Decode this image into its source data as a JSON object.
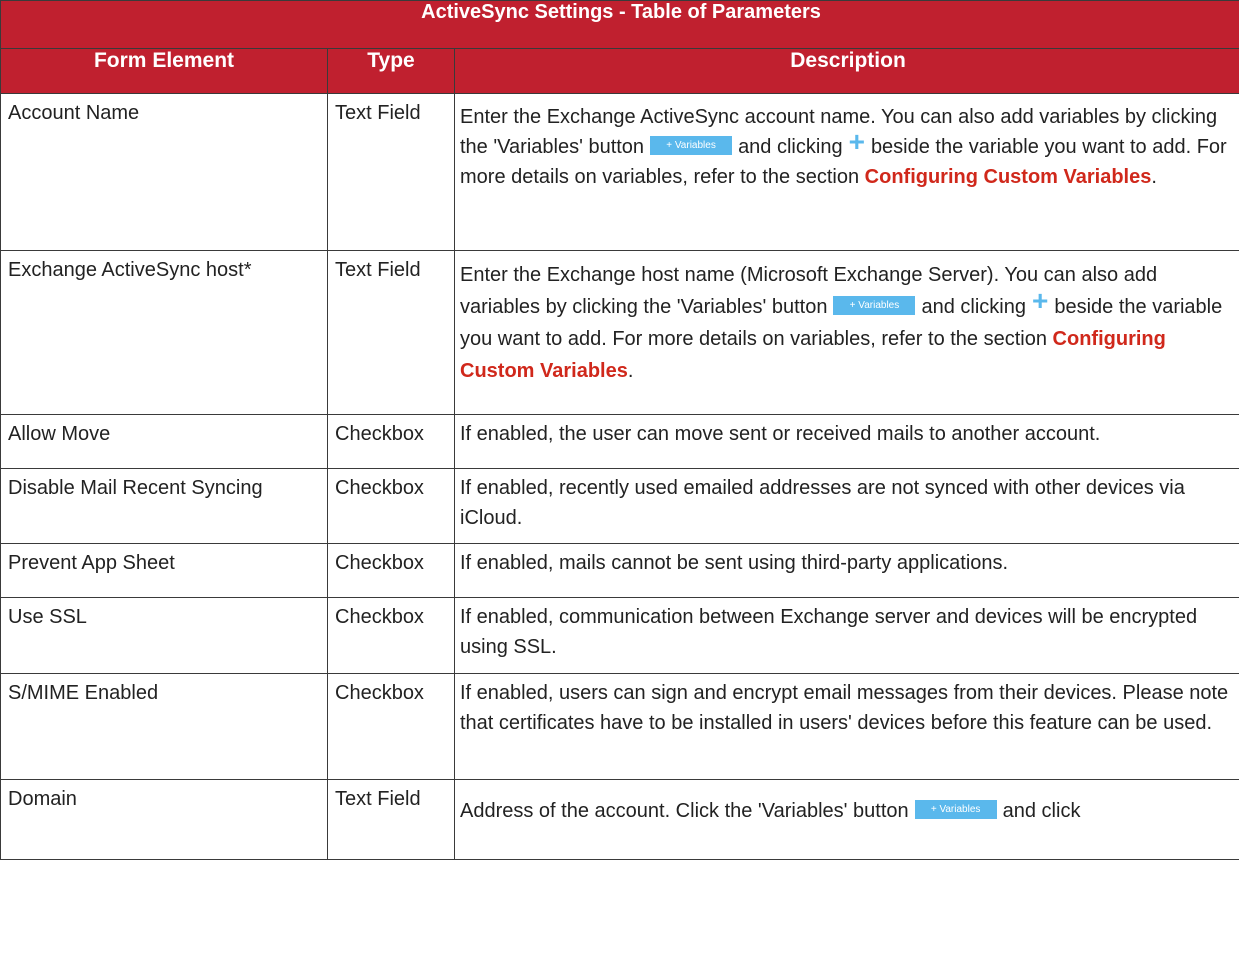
{
  "table": {
    "title": "ActiveSync Settings - Table of Parameters",
    "headers": [
      "Form Element",
      "Type",
      "Description"
    ],
    "variables_button_label": "+ Variables",
    "rows": [
      {
        "element": "Account Name",
        "type": "Text Field",
        "desc": {
          "p1": "Enter the Exchange ActiveSync account name. You can also add variables by clicking the 'Variables' button",
          "p2": "and clicking",
          "p3": "beside the variable you want to add. For more details on variables, refer to the section",
          "link": "Configuring Custom Variables",
          "end": "."
        }
      },
      {
        "element": "Exchange ActiveSync host*",
        "type": "Text Field",
        "desc": {
          "p1": "Enter the Exchange host name (Microsoft Exchange Server). You can also add variables by clicking the 'Variables' button",
          "p2": "and clicking",
          "p3": "beside the variable you want to add. For more details on variables, refer to the section",
          "link": "Configuring Custom Variables",
          "end": "."
        }
      },
      {
        "element": "Allow Move",
        "type": "Checkbox",
        "desc": "If enabled, the user can move sent or received mails to another account."
      },
      {
        "element": "Disable Mail Recent Syncing",
        "type": "Checkbox",
        "desc": "If enabled, recently used emailed addresses are not synced with other devices via iCloud."
      },
      {
        "element": "Prevent App Sheet",
        "type": "Checkbox",
        "desc": "If enabled, mails cannot be sent using third-party applications."
      },
      {
        "element": "Use SSL",
        "type": "Checkbox",
        "desc": "If enabled, communication between Exchange server and devices will be encrypted using SSL."
      },
      {
        "element": "S/MIME Enabled",
        "type": "Checkbox",
        "desc": "If enabled, users can sign and encrypt email messages from their devices. Please note that certificates have to be installed in users' devices before this feature can be used."
      },
      {
        "element": "Domain",
        "type": "Text Field",
        "desc": {
          "p1": "Address of the account. Click the 'Variables' button",
          "p2": "and click"
        }
      }
    ]
  },
  "colors": {
    "header_bg": "#c0202f",
    "link": "#d0281b",
    "variables_button": "#5ab8ec"
  },
  "icons": [
    "plus-icon"
  ]
}
